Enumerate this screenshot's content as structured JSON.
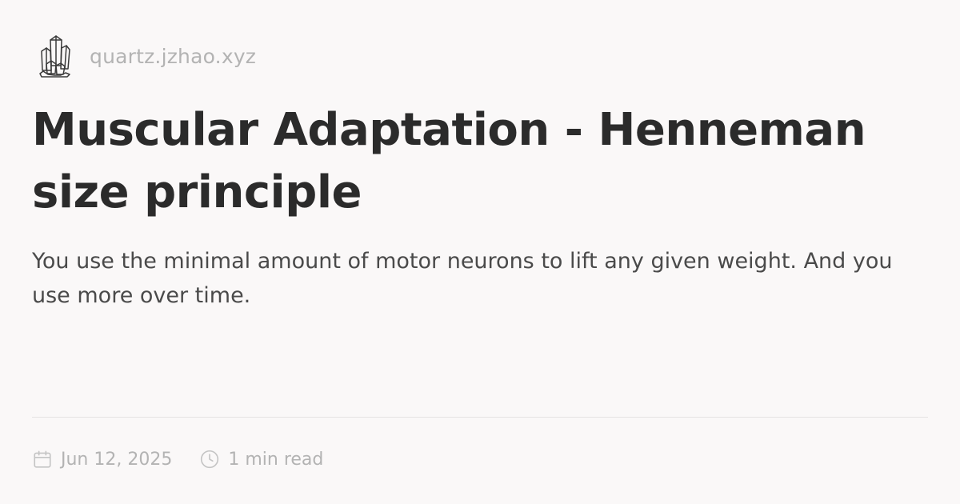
{
  "site": {
    "logo_icon": "crystal-icon",
    "name": "quartz.jzhao.xyz"
  },
  "article": {
    "title": "Muscular Adaptation - Henneman size principle",
    "description": "You use the minimal amount of motor neurons to lift any given weight. And you use more over time."
  },
  "meta": {
    "date_icon": "calendar-icon",
    "date": "Jun 12, 2025",
    "reading_time_icon": "clock-icon",
    "reading_time": "1 min read"
  },
  "colors": {
    "background": "#faf8f8",
    "title": "#2b2b2b",
    "body_text": "#4a4a4a",
    "muted": "#b3b3b3",
    "divider": "#e6e4e4"
  }
}
